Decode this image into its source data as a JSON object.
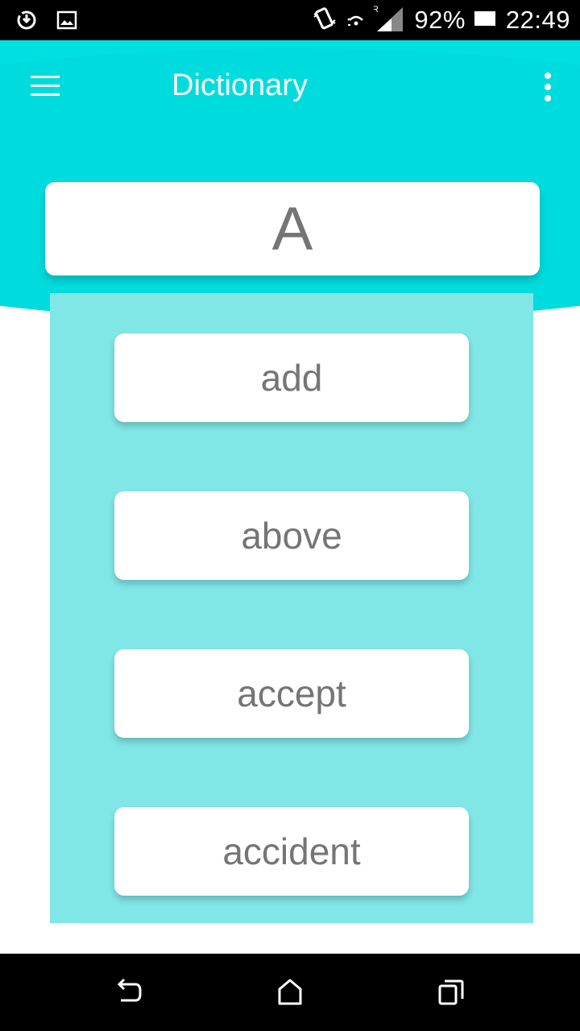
{
  "status_bar": {
    "battery": "92%",
    "time": "22:49",
    "icons": [
      "sync-icon",
      "image-icon",
      "vibrate-icon",
      "wifi-icon",
      "signal-roaming-icon",
      "battery-icon"
    ],
    "roaming_label": "R"
  },
  "app_bar": {
    "title": "Dictionary",
    "menu_icon": "hamburger-menu-icon",
    "overflow_icon": "more-vert-icon"
  },
  "letter": "A",
  "words": [
    "add",
    "above",
    "accept",
    "accident"
  ],
  "nav_bar": {
    "icons": [
      "back-icon",
      "home-icon",
      "recents-icon"
    ]
  },
  "colors": {
    "primary": "#00e0e0",
    "panel": "#80e6e6",
    "card": "#ffffff",
    "text": "#757575"
  }
}
